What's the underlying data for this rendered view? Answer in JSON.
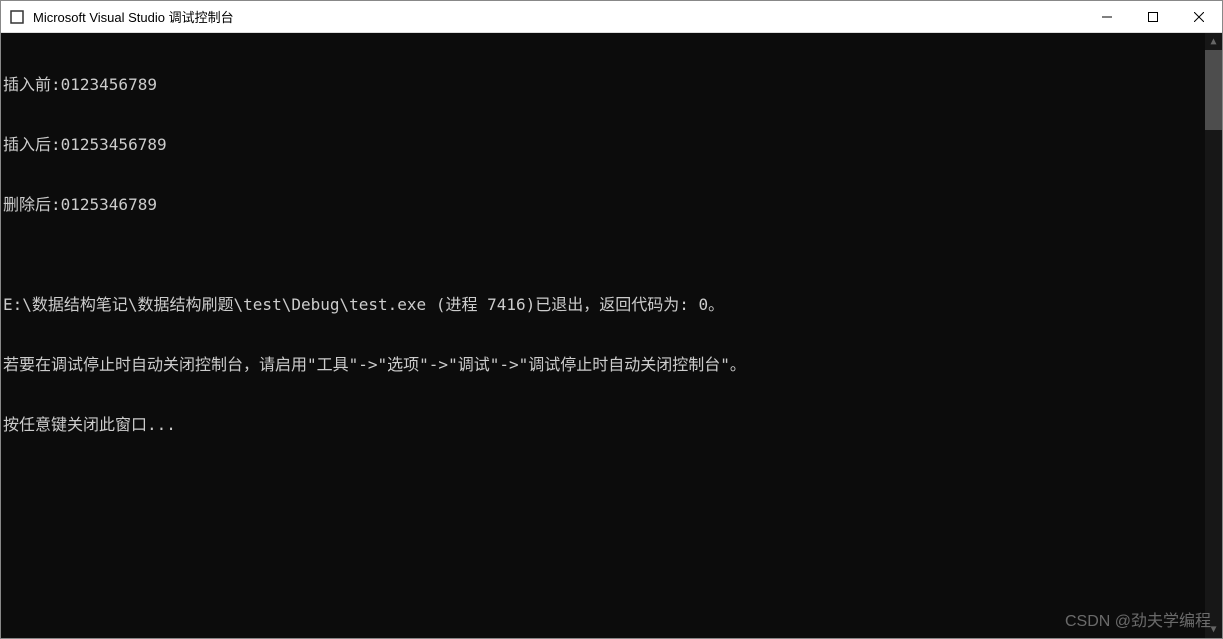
{
  "titlebar": {
    "title": "Microsoft Visual Studio 调试控制台"
  },
  "console": {
    "lines": [
      "插入前:0123456789",
      "插入后:01253456789",
      "删除后:0125346789",
      "",
      "E:\\数据结构笔记\\数据结构刷题\\test\\Debug\\test.exe (进程 7416)已退出，返回代码为: 0。",
      "若要在调试停止时自动关闭控制台，请启用\"工具\"->\"选项\"->\"调试\"->\"调试停止时自动关闭控制台\"。",
      "按任意键关闭此窗口..."
    ]
  },
  "watermark": "CSDN @劲夫学编程"
}
